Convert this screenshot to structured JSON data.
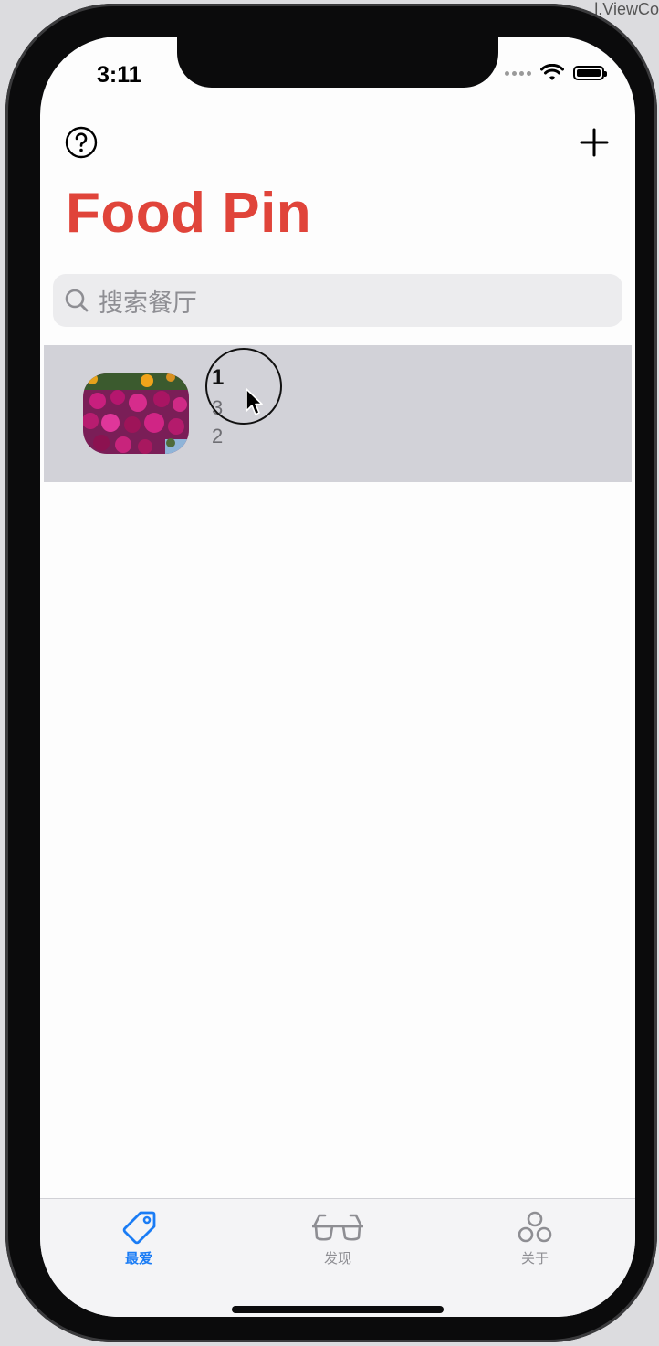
{
  "window": {
    "backdrop_title": "l.ViewCo"
  },
  "status_bar": {
    "time": "3:11"
  },
  "nav": {
    "title": "Food Pin",
    "help_icon": "question-circle-icon",
    "add_icon": "plus-icon"
  },
  "search": {
    "placeholder": "搜索餐厅"
  },
  "restaurants": [
    {
      "name": "1",
      "type": "3",
      "location": "2"
    }
  ],
  "tabs": [
    {
      "label": "最爱",
      "icon": "tag-icon",
      "active": true
    },
    {
      "label": "发现",
      "icon": "eyeglasses-icon",
      "active": false
    },
    {
      "label": "关于",
      "icon": "circles-icon",
      "active": false
    }
  ],
  "colors": {
    "accent": "#e0443a",
    "tab_active": "#1a7cf5",
    "tab_inactive": "#8e8e93",
    "row_selected": "#d2d2d8"
  }
}
